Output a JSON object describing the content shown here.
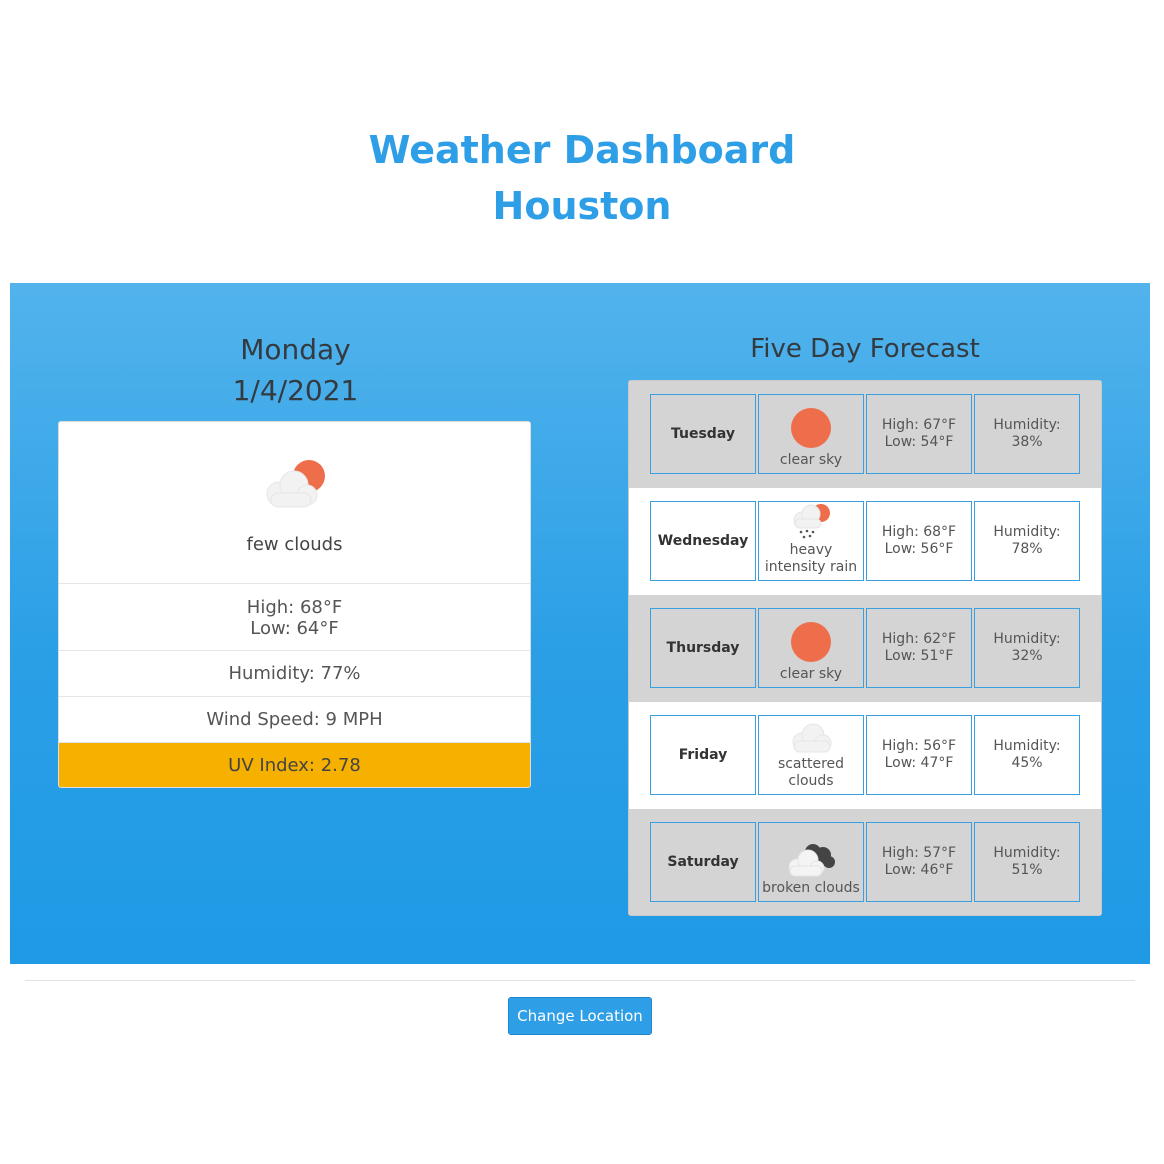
{
  "header": {
    "title": "Weather Dashboard",
    "city": "Houston"
  },
  "current": {
    "day": "Monday",
    "date": "1/4/2021",
    "icon": "few-clouds-icon",
    "description": "few clouds",
    "high": "High: 68°F",
    "low": "Low: 64°F",
    "humidity": "Humidity: 77%",
    "wind": "Wind Speed: 9 MPH",
    "uv": "UV Index: 2.78",
    "uv_color": "#f5b000"
  },
  "forecast": {
    "heading": "Five Day Forecast",
    "days": [
      {
        "day": "Tuesday",
        "icon": "clear-sky-icon",
        "description": "clear sky",
        "high": "High: 67°F",
        "low": "Low: 54°F",
        "humidity_label": "Humidity:",
        "humidity": "38%"
      },
      {
        "day": "Wednesday",
        "icon": "heavy-rain-icon",
        "description": "heavy intensity rain",
        "high": "High: 68°F",
        "low": "Low: 56°F",
        "humidity_label": "Humidity:",
        "humidity": "78%"
      },
      {
        "day": "Thursday",
        "icon": "clear-sky-icon",
        "description": "clear sky",
        "high": "High: 62°F",
        "low": "Low: 51°F",
        "humidity_label": "Humidity:",
        "humidity": "32%"
      },
      {
        "day": "Friday",
        "icon": "scattered-clouds-icon",
        "description": "scattered clouds",
        "high": "High: 56°F",
        "low": "Low: 47°F",
        "humidity_label": "Humidity:",
        "humidity": "45%"
      },
      {
        "day": "Saturday",
        "icon": "broken-clouds-icon",
        "description": "broken clouds",
        "high": "High: 57°F",
        "low": "Low: 46°F",
        "humidity_label": "Humidity:",
        "humidity": "51%"
      }
    ]
  },
  "footer": {
    "change_location_label": "Change Location"
  },
  "colors": {
    "accent": "#2e9ee6",
    "sun": "#ee6e4c",
    "uv_moderate": "#f5b000"
  }
}
